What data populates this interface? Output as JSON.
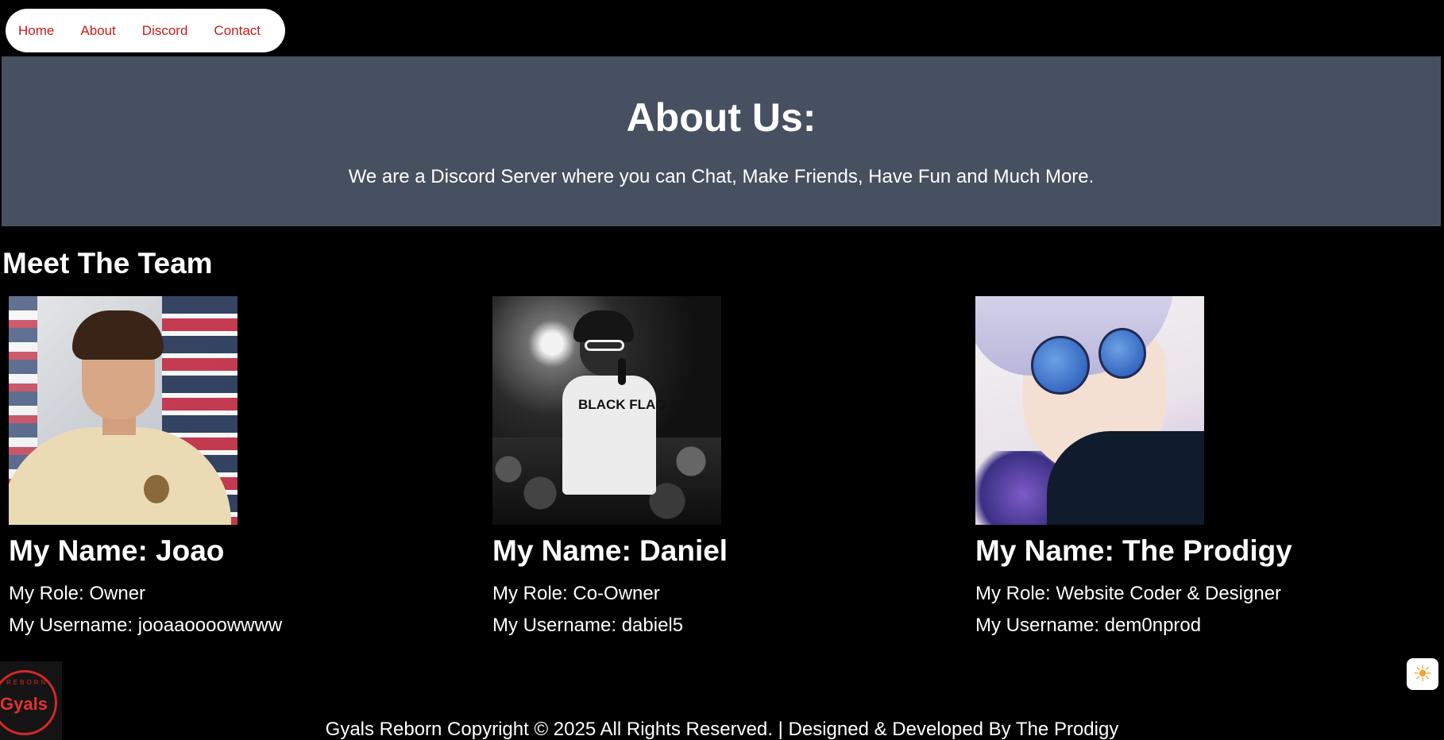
{
  "nav": {
    "items": [
      {
        "label": "Home"
      },
      {
        "label": "About"
      },
      {
        "label": "Discord"
      },
      {
        "label": "Contact"
      }
    ]
  },
  "hero": {
    "title": "About Us:",
    "subtitle": "We are a Discord Server where you can Chat, Make Friends, Have Fun and Much More."
  },
  "team": {
    "heading": "Meet The Team",
    "members": [
      {
        "name": "My Name: Joao",
        "role": "My Role: Owner",
        "username": "My Username: jooaaoooowwww"
      },
      {
        "name": "My Name: Daniel",
        "role": "My Role: Co-Owner",
        "username": "My Username: dabiel5"
      },
      {
        "name": "My Name: The Prodigy",
        "role": "My Role: Website Coder & Designer",
        "username": "My Username: dem0nprod"
      }
    ]
  },
  "photo2": {
    "shirt_text": "BLACK FLAG"
  },
  "logo": {
    "text": "Gyals",
    "ring_text": "REBORN"
  },
  "theme_toggle": {
    "icon": "sun-icon",
    "glyph": "☀"
  },
  "footer": {
    "text": "Gyals Reborn Copyright © 2025 All Rights Reserved. | Designed & Developed By The Prodigy"
  },
  "colors": {
    "nav_link": "#cc1a1a",
    "hero_bg": "#475060",
    "page_bg": "#000000"
  }
}
